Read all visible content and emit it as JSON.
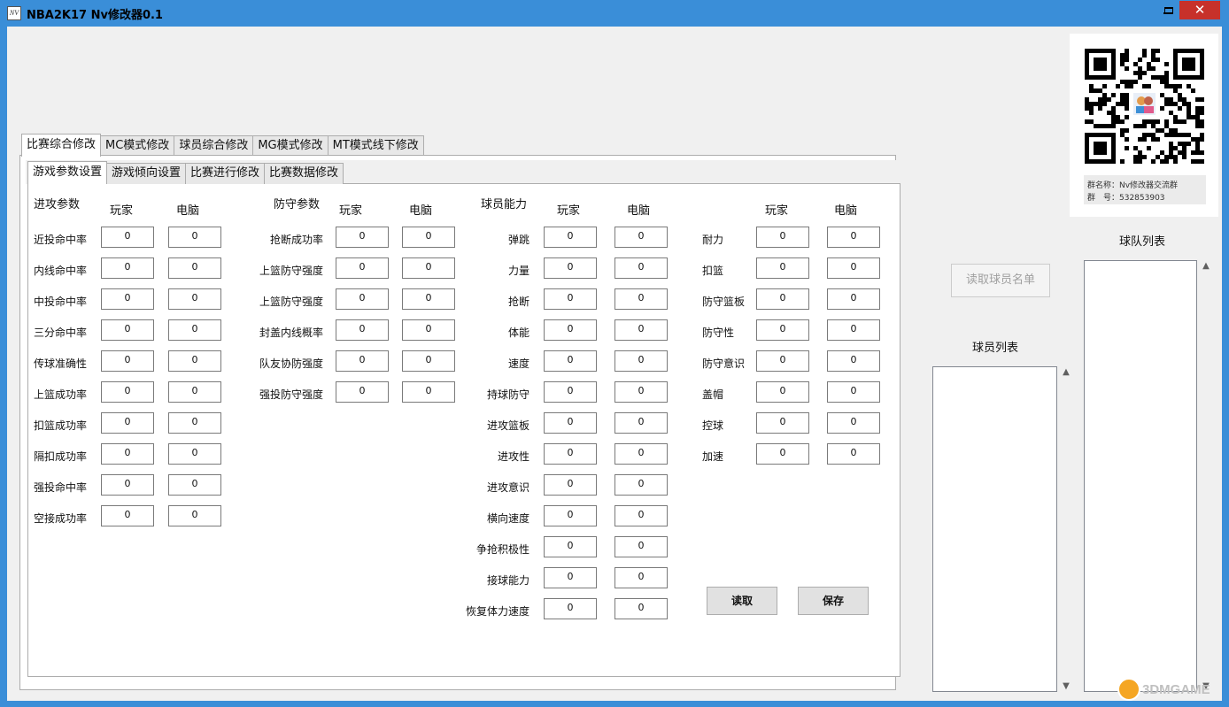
{
  "window": {
    "title": "NBA2K17 Nv修改器0.1",
    "close_glyph": "✕"
  },
  "main_tabs": [
    "比赛综合修改",
    "MC模式修改",
    "球员综合修改",
    "MG模式修改",
    "MT模式线下修改"
  ],
  "sub_tabs": [
    "游戏参数设置",
    "游戏倾向设置",
    "比赛进行修改",
    "比赛数据修改"
  ],
  "col_player": "玩家",
  "col_cpu": "电脑",
  "offense": {
    "heading": "进攻参数",
    "rows": [
      {
        "label": "近投命中率",
        "player": "0",
        "cpu": "0"
      },
      {
        "label": "内线命中率",
        "player": "0",
        "cpu": "0"
      },
      {
        "label": "中投命中率",
        "player": "0",
        "cpu": "0"
      },
      {
        "label": "三分命中率",
        "player": "0",
        "cpu": "0"
      },
      {
        "label": "传球准确性",
        "player": "0",
        "cpu": "0"
      },
      {
        "label": "上篮成功率",
        "player": "0",
        "cpu": "0"
      },
      {
        "label": "扣篮成功率",
        "player": "0",
        "cpu": "0"
      },
      {
        "label": "隔扣成功率",
        "player": "0",
        "cpu": "0"
      },
      {
        "label": "强投命中率",
        "player": "0",
        "cpu": "0"
      },
      {
        "label": "空接成功率",
        "player": "0",
        "cpu": "0"
      }
    ]
  },
  "defense": {
    "heading": "防守参数",
    "rows": [
      {
        "label": "抢断成功率",
        "player": "0",
        "cpu": "0"
      },
      {
        "label": "上篮防守强度",
        "player": "0",
        "cpu": "0"
      },
      {
        "label": "上篮防守强度",
        "player": "0",
        "cpu": "0"
      },
      {
        "label": "封盖内线概率",
        "player": "0",
        "cpu": "0"
      },
      {
        "label": "队友协防强度",
        "player": "0",
        "cpu": "0"
      },
      {
        "label": "强投防守强度",
        "player": "0",
        "cpu": "0"
      }
    ]
  },
  "ability": {
    "heading": "球员能力",
    "rows": [
      {
        "label": "弹跳",
        "player": "0",
        "cpu": "0"
      },
      {
        "label": "力量",
        "player": "0",
        "cpu": "0"
      },
      {
        "label": "抢断",
        "player": "0",
        "cpu": "0"
      },
      {
        "label": "体能",
        "player": "0",
        "cpu": "0"
      },
      {
        "label": "速度",
        "player": "0",
        "cpu": "0"
      },
      {
        "label": "持球防守",
        "player": "0",
        "cpu": "0"
      },
      {
        "label": "进攻篮板",
        "player": "0",
        "cpu": "0"
      },
      {
        "label": "进攻性",
        "player": "0",
        "cpu": "0"
      },
      {
        "label": "进攻意识",
        "player": "0",
        "cpu": "0"
      },
      {
        "label": "横向速度",
        "player": "0",
        "cpu": "0"
      },
      {
        "label": "争抢积极性",
        "player": "0",
        "cpu": "0"
      },
      {
        "label": "接球能力",
        "player": "0",
        "cpu": "0"
      },
      {
        "label": "恢复体力速度",
        "player": "0",
        "cpu": "0"
      }
    ]
  },
  "ability2": {
    "rows": [
      {
        "label": "耐力",
        "player": "0",
        "cpu": "0"
      },
      {
        "label": "扣篮",
        "player": "0",
        "cpu": "0"
      },
      {
        "label": "防守篮板",
        "player": "0",
        "cpu": "0"
      },
      {
        "label": "防守性",
        "player": "0",
        "cpu": "0"
      },
      {
        "label": "防守意识",
        "player": "0",
        "cpu": "0"
      },
      {
        "label": "盖帽",
        "player": "0",
        "cpu": "0"
      },
      {
        "label": "控球",
        "player": "0",
        "cpu": "0"
      },
      {
        "label": "加速",
        "player": "0",
        "cpu": "0"
      }
    ]
  },
  "buttons": {
    "read": "读取",
    "save": "保存",
    "load_players": "读取球员名单"
  },
  "lists": {
    "player_list": "球员列表",
    "team_list": "球队列表"
  },
  "qr": {
    "group_name": "群名称：Nv修改器交流群",
    "group_number": "群　号：532853903"
  },
  "watermark": "3DMGAME"
}
